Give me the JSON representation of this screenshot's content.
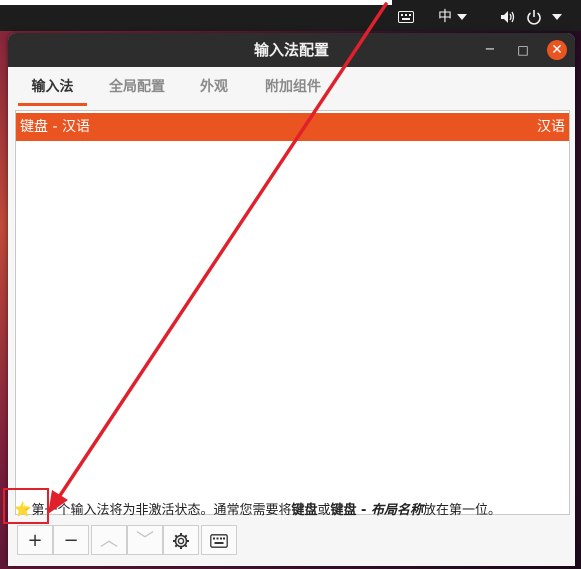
{
  "topbar": {
    "keyboard_icon": "keyboard-icon",
    "input_method": "中",
    "volume_icon": "volume-icon",
    "power_icon": "power-icon"
  },
  "window": {
    "title": "输入法配置",
    "minimize": "−",
    "maximize": "□",
    "close": "✕"
  },
  "tabs": [
    {
      "label": "输入法",
      "active": true
    },
    {
      "label": "全局配置",
      "active": false
    },
    {
      "label": "外观",
      "active": false
    },
    {
      "label": "附加组件",
      "active": false
    }
  ],
  "list": {
    "rows": [
      {
        "name": "键盘 - 汉语",
        "language": "汉语",
        "selected": true
      }
    ]
  },
  "hint": {
    "star": "⭐",
    "part1": "第一个输入法将为非激活状态。通常您需要将",
    "bold1": "键盘",
    "part2": "或",
    "bold2": "键盘 - ",
    "bolditalic": "布局名称",
    "part3": "放在第一位。"
  },
  "toolbar": {
    "add": "+",
    "remove": "−",
    "up": "︿",
    "down": "﹀",
    "configure_icon": "gear-icon",
    "keyboard_icon": "keyboard-icon"
  },
  "colors": {
    "accent": "#e95420",
    "annotation": "#e0202a"
  }
}
